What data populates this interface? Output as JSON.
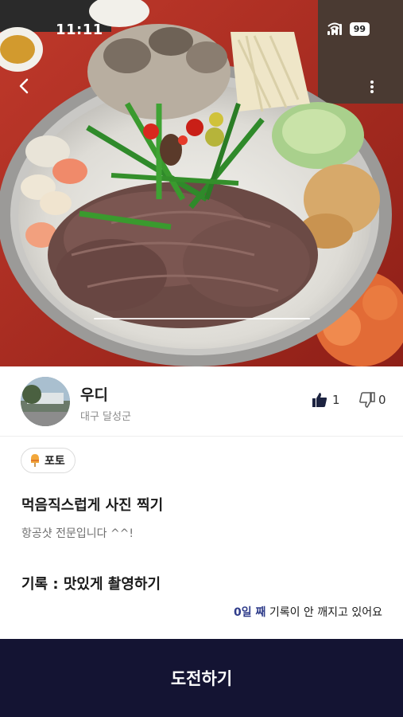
{
  "status_bar": {
    "time": "11:11",
    "battery": "99",
    "icons": [
      "signal-icon",
      "wifi-icon",
      "battery-icon"
    ]
  },
  "header": {
    "back_icon": "chevron-left-icon",
    "more_icon": "more-vertical-icon"
  },
  "photo": {
    "subject": "hot pot with sliced beef, mushrooms and chives",
    "page_count": 1,
    "current_page": 1
  },
  "user": {
    "name": "우디",
    "location": "대구 달성군"
  },
  "reactions": {
    "like_icon": "thumbs-up-icon",
    "like_count": "1",
    "dislike_icon": "thumbs-down-icon",
    "dislike_count": "0"
  },
  "tag": {
    "icon": "popsicle-icon",
    "label": "포토"
  },
  "post": {
    "title": "먹음직스럽게 사진 찍기",
    "description": "항공샷 전문입니다 ^^!",
    "record": "기록 : 맛있게 촬영하기"
  },
  "streak": {
    "days": "0일 째",
    "message": " 기록이 안 깨지고 있어요"
  },
  "cta": {
    "label": "도전하기"
  },
  "colors": {
    "cta_background": "#141433",
    "streak_accent": "#2f3c8a",
    "text_primary": "#1a1a1a",
    "text_secondary": "#8a8a8a"
  }
}
